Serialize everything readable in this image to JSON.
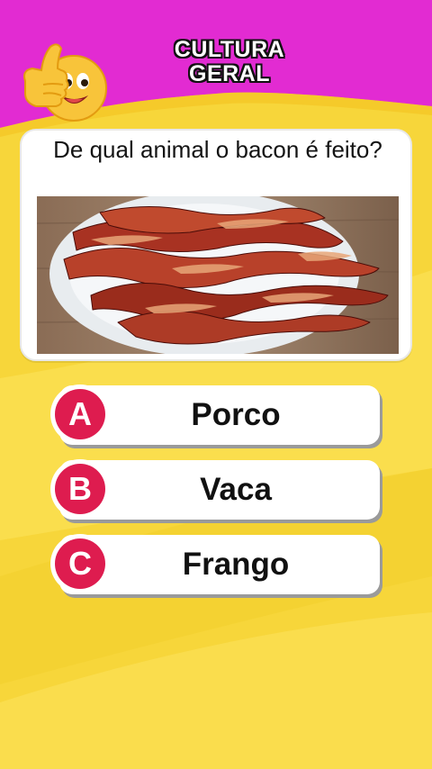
{
  "header": {
    "title_line1": "CULTURA",
    "title_line2": "GERAL",
    "emoji_icon": "thumbs-up-smiley-icon"
  },
  "question": {
    "text": "De qual animal o bacon é feito?",
    "image": "bacon-plate-photo"
  },
  "answers": [
    {
      "letter": "A",
      "label": "Porco"
    },
    {
      "letter": "B",
      "label": "Vaca"
    },
    {
      "letter": "C",
      "label": "Frango"
    }
  ],
  "colors": {
    "header_magenta": "#e22bd2",
    "background_yellow": "#f7d93a",
    "badge_red": "#de1c4f"
  }
}
